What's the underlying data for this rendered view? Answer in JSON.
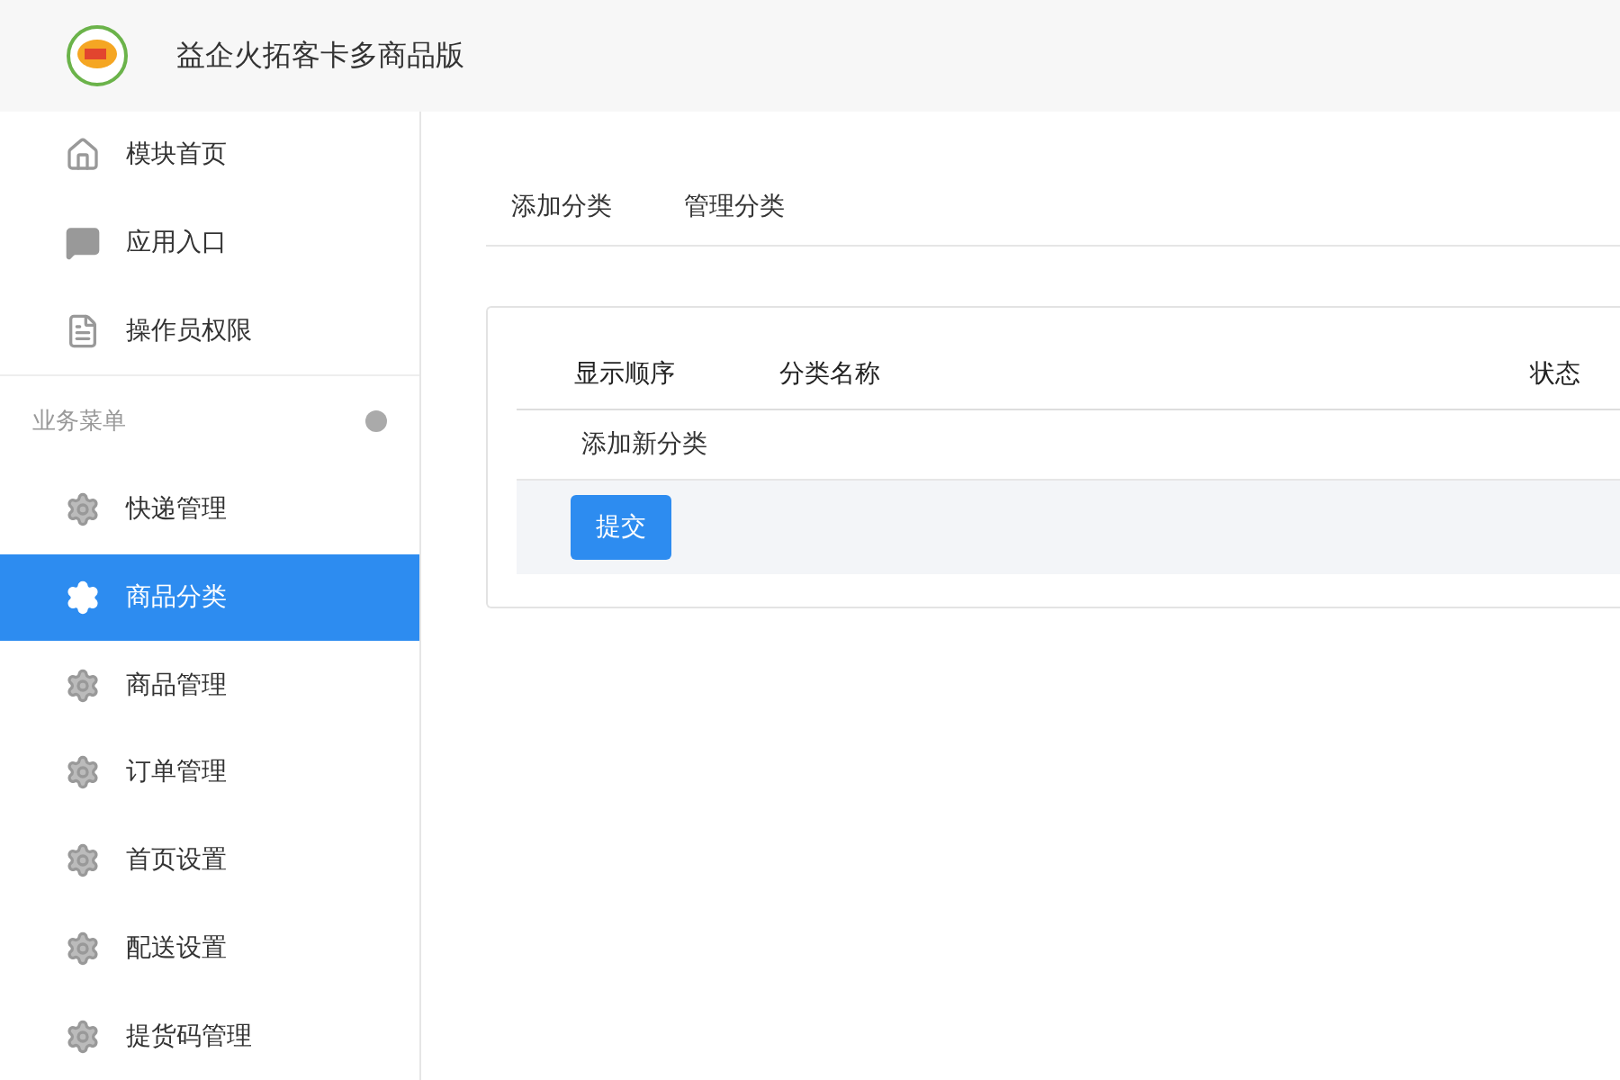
{
  "header": {
    "title": "益企火拓客卡多商品版"
  },
  "sidebar": {
    "top_items": [
      {
        "label": "模块首页",
        "kind": "home"
      },
      {
        "label": "应用入口",
        "kind": "chat"
      },
      {
        "label": "操作员权限",
        "kind": "document"
      }
    ],
    "section_label": "业务菜单",
    "items": [
      {
        "label": "快递管理",
        "selected": false
      },
      {
        "label": "商品分类",
        "selected": true
      },
      {
        "label": "商品管理",
        "selected": false
      },
      {
        "label": "订单管理",
        "selected": false
      },
      {
        "label": "首页设置",
        "selected": false
      },
      {
        "label": "配送设置",
        "selected": false
      },
      {
        "label": "提货码管理",
        "selected": false
      }
    ]
  },
  "tabs": [
    {
      "label": "添加分类"
    },
    {
      "label": "管理分类"
    }
  ],
  "table": {
    "columns": [
      "显示顺序",
      "分类名称",
      "状态"
    ],
    "add_link": "添加新分类",
    "submit_button": "提交"
  }
}
